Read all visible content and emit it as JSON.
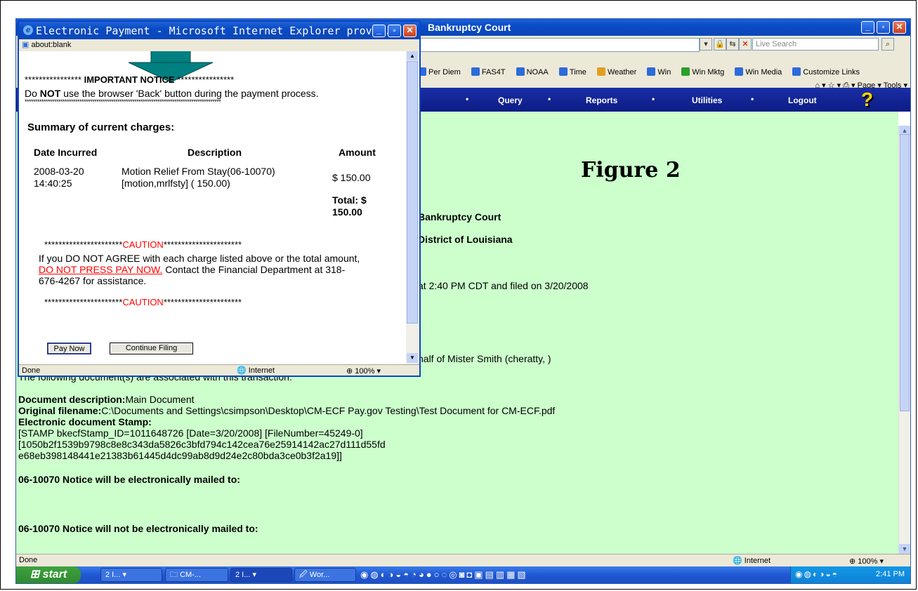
{
  "main_window": {
    "title_fragment": "Bankruptcy Court",
    "search_placeholder": "Live Search",
    "links": [
      "Per Diem",
      "FAS4T",
      "NOAA",
      "Time",
      "Weather",
      "Win",
      "Win Mktg",
      "Win Media",
      "Customize Links"
    ],
    "tools": "Page ▾  Tools ▾",
    "nav": [
      "Query",
      "Reports",
      "Utilities",
      "Logout"
    ],
    "status_left": "Done",
    "status_zone": "Internet",
    "status_zoom": "100%"
  },
  "content": {
    "figure_title": "Figure 2",
    "court_line1": "Bankruptcy Court",
    "court_line2": "District of Louisiana",
    "received_line": "at 2:40 PM CDT and filed on 3/20/2008",
    "behalf_line": "half of Mister Smith (cheratty, )",
    "assoc_docs": "The following document(s) are associated with this transaction:",
    "doc_desc_label": "Document description:",
    "doc_desc_value": "Main Document",
    "orig_filename_label": "Original filename:",
    "orig_filename_value": "C:\\Documents and Settings\\csimpson\\Desktop\\CM-ECF Pay.gov Testing\\Test Document for CM-ECF.pdf",
    "stamp_label": "Electronic document Stamp:",
    "stamp_line1": "[STAMP bkecfStamp_ID=1011648726 [Date=3/20/2008] [FileNumber=45249-0]",
    "stamp_line2": "[1050b2f1539b9798c8e8c343da5826c3bfd794c142cea76e25914142ac27d111d55fd",
    "stamp_line3": "e68eb398148441e21383b61445d4dc99ab8d9d24e2c80bda3ce0b3f2a19]]",
    "mailed_to": "06-10070 Notice will be electronically mailed to:",
    "not_mailed_to": "06-10070 Notice will not be electronically mailed to:"
  },
  "taskbar": {
    "start": "start",
    "tasks": [
      "2 I...",
      "CM-...",
      "2 I...",
      "Wor..."
    ],
    "clock": "2:41 PM"
  },
  "popup": {
    "title": "Electronic Payment - Microsoft Internet Explorer provi...",
    "address": "about:blank",
    "notice_stars_left": "****************",
    "notice_heading": "IMPORTANT NOTICE",
    "notice_stars_right": "****************",
    "notice_pre": "Do ",
    "notice_bold": "NOT",
    "notice_post": " use the browser 'Back' button during the payment process.",
    "stars_row": "*********************************************************************************************",
    "summary_heading": "Summary of current charges:",
    "col_date": "Date Incurred",
    "col_desc": "Description",
    "col_amount": "Amount",
    "row_date": "2008-03-20",
    "row_time": "14:40:25",
    "row_desc1": "Motion Relief From Stay(06-10070)",
    "row_desc2": "[motion,mrlfsty] ( 150.00)",
    "row_amount": "$ 150.00",
    "total_label": "Total: $",
    "total_value": "150.00",
    "caution_stars": "**********************",
    "caution_word": "CAUTION",
    "caution_text1": "If you DO NOT AGREE with each charge listed above or the total amount, ",
    "caution_link": "DO NOT PRESS PAY NOW.",
    "caution_text2": " Contact the Financial Department at 318-676-4267 for assistance.",
    "pay_now": "Pay Now",
    "continue_filing": "Continue Filing",
    "status_left": "Done",
    "status_zone": "Internet",
    "status_zoom": "100%"
  },
  "colors": {
    "nav_bg": "#0c1b86",
    "content_bg": "#ccffcc",
    "caution": "#ff0000",
    "arrow": "#008080"
  }
}
